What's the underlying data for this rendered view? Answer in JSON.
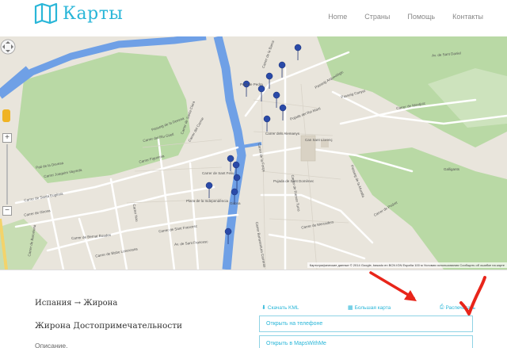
{
  "header": {
    "logo_text": "Карты",
    "nav": [
      "Home",
      "Страны",
      "Помощь",
      "Контакты"
    ]
  },
  "map": {
    "footer": "Картографические данные © 2014 Google, basado en BCN IGN España   100 м   Условия использования   Сообщить об ошибке на карте",
    "streets": [
      "Carrer del Riu Güell",
      "Carrer Joaquim Vayreda",
      "Carrer Figuerola",
      "Pont de Pedra",
      "Carrer de Santa Clara",
      "Passeig de la Devesa",
      "Carrer de Montjuïc",
      "Passeig Canyet",
      "Carrer de Sant Francesc",
      "Av. de Sant Francesc",
      "Carrer de Girona",
      "Carrer Nou",
      "Carrer del Carme",
      "Carrer de Pedret",
      "Can Sant Llorenç",
      "Carrer de Ramon Turró",
      "Carrer dels Alemanys",
      "Placa de la Independència",
      "Carrer de la Força",
      "Av. de Sant Daniel",
      "Pujada del Rei Martí",
      "Passeig Arqueològic",
      "Carrer de la Barca",
      "Pujada de Sant Domènec",
      "Pati de la Devesa",
      "Carrer de Bernat Boades",
      "Carrer de Santa Eugènia",
      "Carrer de Bisbe Lorenzana",
      "Galligants",
      "Carrer de Mercaders",
      "Carrer de Sant Feliu",
      "Carrer de Barcelona",
      "Carrer Bonaventura Carreras",
      "Passeig de la Muralla",
      "Girona"
    ]
  },
  "breadcrumb": {
    "country": "Испания",
    "arrow": "→",
    "city": "Жирона"
  },
  "place_title": "Жирона Достопримечательности",
  "description_label": "Описание.",
  "links": {
    "kml": "Скачать KML",
    "bigmap": "Большая карта",
    "print": "Распечатать"
  },
  "buttons": {
    "open_phone": "Открыть на телефоне",
    "open_mapswithme": "Открыть в MapsWithMe"
  },
  "colors": {
    "accent": "#29b6d8",
    "annotation": "#e8251a",
    "river": "#6fa0e6",
    "park": "#b9d9a5"
  }
}
